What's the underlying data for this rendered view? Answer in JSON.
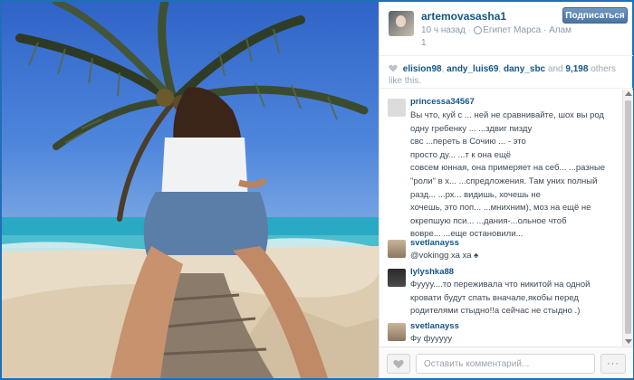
{
  "photo": {
    "description_icon": "beach-palm-photo"
  },
  "post": {
    "username": "artemovasasha1",
    "time_ago": "10 ч назад",
    "location": "Египет Марса · Алам",
    "meta_extra": "1",
    "follow_label": "Подписаться",
    "colors": {
      "link": "#125688",
      "muted": "#8a9aa8",
      "follow": "#4a75a3"
    }
  },
  "likes": {
    "users": [
      "elision98",
      "andy_luis69",
      "dany_sbc"
    ],
    "and_word": "and",
    "count": "9,198",
    "others_text": "others like this."
  },
  "comments": [
    {
      "user": "princessa34567",
      "lines": [
        "Вы что, куй с ... ней не сравнивайте, шох вы род",
        "одну гребенку ...                        ...здвиг пизду",
        "свс          ...переть в Сочию ...           - это",
        "просто ду...                          ...т к она ещё",
        "совсем юнная, она примеряет на себ... ...разные",
        "\"роли\" в х...              ...спредложения. Там уних полный",
        "разд...                    ...рх... видишь, хочешь не",
        "хочешь, это поп...                ...мнихним), моз на ещё не",
        "окрепшую пси...                  ...дания-...ольное чтоб",
        "вовре...  ...еще остановили..."
      ]
    },
    {
      "user": "svetlanayss",
      "lines": [
        "@vokingg ха ха ♠"
      ]
    },
    {
      "user": "lylyshka88",
      "lines": [
        "Фуууу....то переживала что никитой на одной",
        "кровати будут спать вначале,якобы перед",
        "родителями стыдно!!а сейчас не стыдно .)"
      ]
    },
    {
      "user": "svetlanayss",
      "lines": [
        "Фу фууууу"
      ]
    }
  ],
  "footer": {
    "comment_placeholder": "Оставить комментарий...",
    "more_label": "···"
  }
}
